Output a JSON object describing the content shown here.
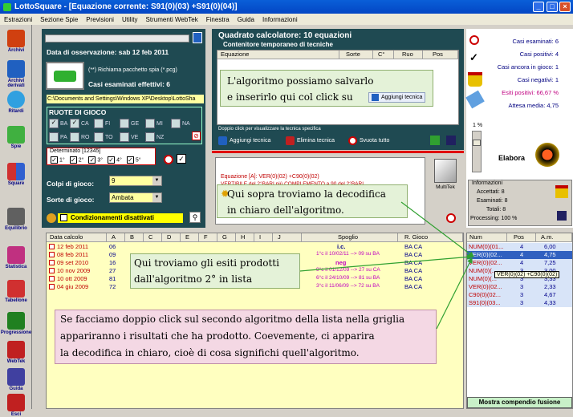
{
  "window": {
    "title": "LottoSquare - [Equazione corrente: S91(0)(03) +S91(0)(04)]"
  },
  "menu": [
    "Estrazioni",
    "Sezione Spie",
    "Previsioni",
    "Utility",
    "Strumenti WebTek",
    "Finestra",
    "Guida",
    "Informazioni"
  ],
  "sidebar": [
    {
      "label": "Archivi",
      "icon": "pencil-icon",
      "color": "#d04010"
    },
    {
      "label": "Archivi derivati",
      "icon": "monitor-icon",
      "color": "#2060c0"
    },
    {
      "label": "Ritardi",
      "icon": "clock-icon",
      "color": "#30a0e0"
    },
    {
      "label": "Spie",
      "icon": "battery-icon",
      "color": "#40b040"
    },
    {
      "label": "Square",
      "icon": "squares-icon",
      "color": "#e0a020"
    },
    {
      "label": "Equilibrio",
      "icon": "scales-icon",
      "color": "#606060"
    },
    {
      "label": "Statistica",
      "icon": "chart-icon",
      "color": "#c03080"
    },
    {
      "label": "Tabellone",
      "icon": "calendar-icon",
      "color": "#d03030"
    },
    {
      "label": "Progressione",
      "icon": "dollar-icon",
      "color": "#208020"
    },
    {
      "label": "WebTek",
      "icon": "webtek-icon",
      "color": "#c02020"
    },
    {
      "label": "Guida",
      "icon": "book-icon",
      "color": "#4040a0"
    },
    {
      "label": "Esci",
      "icon": "exit-icon",
      "color": "#c02020"
    }
  ],
  "left": {
    "date_label": "Data di osservazione:  sab 12 feb 2011",
    "richiama": "(**) Richiama pacchetto spia (*.pcg)",
    "casi_esaminati": "Casi esaminati effettivi: 6",
    "path": "C:\\Documents and Settings\\Windows XP\\Desktop\\LottoSha",
    "ruote_title": "RUOTE DI GIOCO",
    "ruote": [
      {
        "code": "BA",
        "checked": true
      },
      {
        "code": "CA",
        "checked": true
      },
      {
        "code": "FI",
        "checked": false
      },
      {
        "code": "GE",
        "checked": false
      },
      {
        "code": "MI",
        "checked": false
      },
      {
        "code": "NA",
        "checked": false
      },
      {
        "code": "PA",
        "checked": false
      },
      {
        "code": "RO",
        "checked": false
      },
      {
        "code": "TO",
        "checked": false
      },
      {
        "code": "VE",
        "checked": false
      },
      {
        "code": "NZ",
        "checked": false
      }
    ],
    "determinato_title": "Determinato [12345]",
    "determinato": [
      "1°",
      "2°",
      "3°",
      "4°",
      "5°"
    ],
    "colpi_label": "Colpi di gioco:",
    "colpi_value": "9",
    "sorte_label": "Sorte di gioco:",
    "sorte_value": "Ambata",
    "condizionamenti": "Condizionamenti disattivati"
  },
  "quadrato": {
    "title": "Quadrato calcolatore: 10 equazioni",
    "subtitle": "Contenitore temporaneo di tecniche",
    "columns": [
      "Equazione",
      "Sorte",
      "C°",
      "Ruo",
      "Pos"
    ],
    "hint": "Doppio click per visualizzare la tecnica specifica",
    "aggiungi": "Aggiungi tecnica",
    "elimina": "Elimina tecnica",
    "svuota": "Svuota tutto"
  },
  "decodifica": {
    "equazione": "Equazione [A]:  VER(0)(02) +C90(0)(02)",
    "descr": "VERTIBILE del 2°BARI più  COMPLEMENTO a 90 del 2°BARI",
    "multitek": "MultiTek"
  },
  "stats": {
    "casi_esaminati": "Casi esaminati: 6",
    "casi_positivi": "Casi positivi: 4",
    "casi_gioco": "Casi ancora in gioco: 1",
    "casi_negativi": "Casi negativi: 1",
    "esiti": "Esiti positivi: 66,67 %",
    "attesa": "Attesa media: 4,75",
    "elabora": "Elabora",
    "slider_label": "1 %",
    "info_title": "Informazioni",
    "accettati": "Accettati:  8",
    "esaminati": "Esaminati:  8",
    "totali": "Totali:  8",
    "processing": "Processing:  100 %"
  },
  "grid": {
    "columns": [
      "Data calcolo",
      "A",
      "B",
      "C",
      "D",
      "E",
      "F",
      "G",
      "H",
      "I",
      "J",
      "Spoglio",
      "R. Gioco"
    ],
    "rows": [
      {
        "date": "12 feb 2011",
        "a": "06",
        "spoglio": "i.c.",
        "ruote": "BA CA"
      },
      {
        "date": "08 feb 2011",
        "a": "09",
        "spoglio": "1°c il 10/02/11 --> 09 su BA",
        "ruote": "BA CA"
      },
      {
        "date": "09 set 2010",
        "a": "16",
        "spoglio": "neg",
        "ruote": "BA CA"
      },
      {
        "date": "10 nov 2009",
        "a": "27",
        "spoglio": "9°c il 01/12/09 --> 27 su CA",
        "ruote": "BA CA"
      },
      {
        "date": "10 ott 2009",
        "a": "81",
        "spoglio": "6°c il 24/10/09 --> 81 su BA",
        "ruote": "BA CA"
      },
      {
        "date": "04 giu 2009",
        "a": "72",
        "spoglio": "3°c il 11/06/09 --> 72 su BA",
        "ruote": "BA CA"
      }
    ]
  },
  "rgrid": {
    "columns": [
      "Num",
      "Pos",
      "A.m."
    ],
    "rows": [
      {
        "num": "NUM(0)(01...",
        "pos": "4",
        "am": "6,00"
      },
      {
        "num": "VER(0)(02...",
        "pos": "4",
        "am": "4,75"
      },
      {
        "num": "VER(0)(02...",
        "pos": "4",
        "am": "7,25"
      },
      {
        "num": "NUM(0)(...",
        "pos": "3",
        "am": "3,00"
      },
      {
        "num": "NUM(0)(...",
        "pos": "3",
        "am": "3,33"
      },
      {
        "num": "VER(0)(02...",
        "pos": "3",
        "am": "2,33"
      },
      {
        "num": "C90(0)(02...",
        "pos": "3",
        "am": "4,67"
      },
      {
        "num": "S91(0)(03...",
        "pos": "3",
        "am": "4,33"
      }
    ],
    "tooltip": "VER(0)(02) +C90(0)(02)",
    "mostra": "Mostra compendio fusione"
  },
  "notes": {
    "n1a": "L'algoritmo possiamo salvarlo",
    "n1b": "e inserirlo qui col click su",
    "n1btn": "Aggiungi tecnica",
    "n2a": "Qui sopra troviamo la decodifica",
    "n2b": "in chiaro dell'algoritmo.",
    "n3a": "Qui troviamo gli esiti prodotti",
    "n3b": "dall'algoritmo 2° in lista",
    "n4a": "Se facciamo doppio click sul secondo algoritmo della lista nella griglia",
    "n4b": "appariranno i risultati che ha prodotto. Coevemente, ci apparira",
    "n4c": "la decodifica in chiaro, cioè di cosa significhi quell'algoritmo."
  }
}
